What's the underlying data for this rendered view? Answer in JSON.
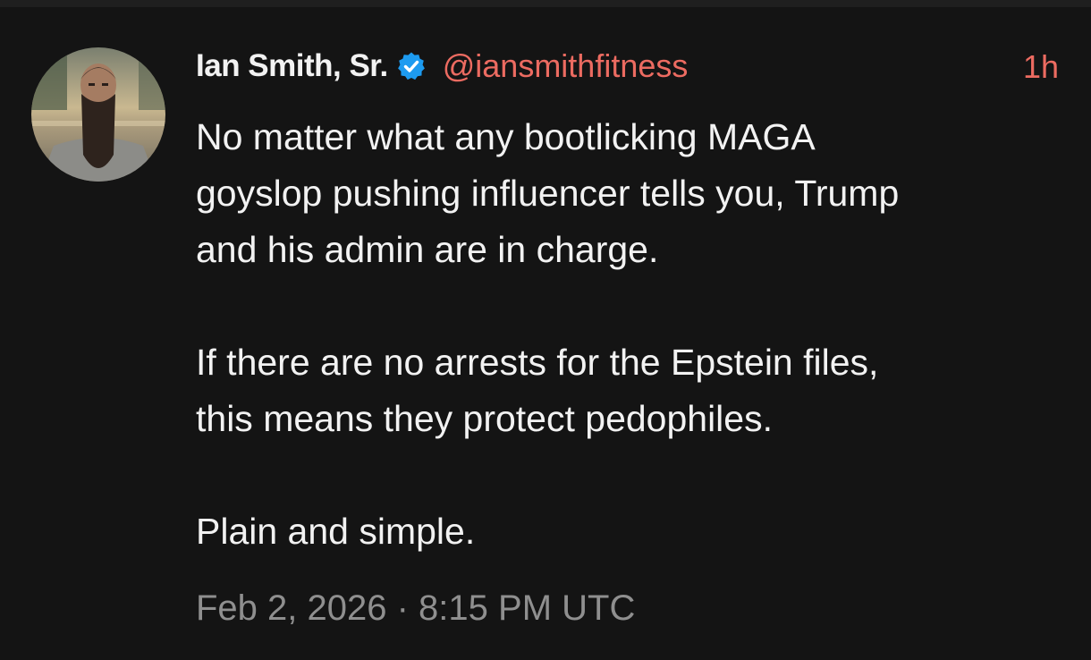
{
  "tweet": {
    "author": {
      "display_name": "Ian Smith, Sr.",
      "handle": "@iansmithfitness",
      "verified": true,
      "verified_icon": "verified-badge-icon"
    },
    "time_ago": "1h",
    "body": {
      "para1_lines": [
        "No matter what any bootlicking MAGA",
        "goyslop pushing influencer tells you, Trump",
        "and his admin are in charge."
      ],
      "para2_lines": [
        "If there are no arrests for the Epstein files,",
        "this means they protect pedophiles."
      ],
      "para3_lines": [
        "Plain and simple."
      ]
    },
    "timestamp": "Feb 2, 2026 · 8:15 PM UTC"
  },
  "colors": {
    "background": "#141414",
    "text": "#f2f2f2",
    "handle": "#ec6b61",
    "muted": "#8f8f8f",
    "verified": "#1d9bf0"
  }
}
